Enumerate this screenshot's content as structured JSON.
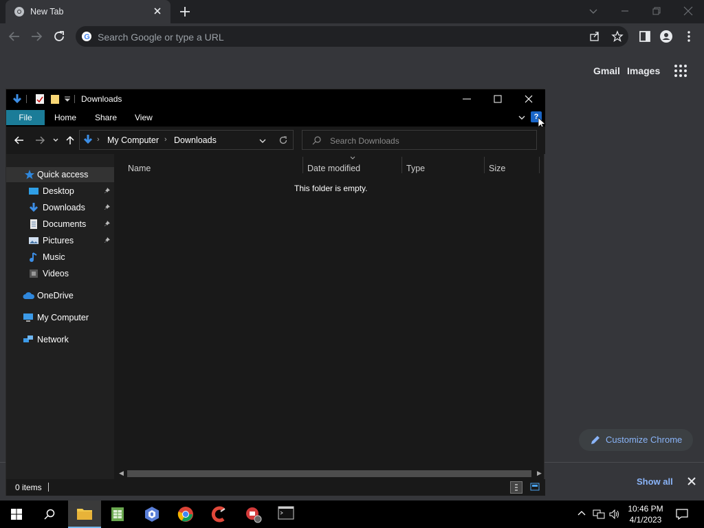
{
  "chrome": {
    "tab_title": "New Tab",
    "omnibox_placeholder": "Search Google or type a URL",
    "gmail": "Gmail",
    "images": "Images",
    "customize": "Customize Chrome",
    "show_all": "Show all"
  },
  "explorer": {
    "title": "Downloads",
    "ribbon": {
      "file": "File",
      "home": "Home",
      "share": "Share",
      "view": "View",
      "help": "?"
    },
    "address": {
      "crumbs": [
        "My Computer",
        "Downloads"
      ]
    },
    "search_placeholder": "Search Downloads",
    "nav": {
      "quick_access": "Quick access",
      "desktop": "Desktop",
      "downloads": "Downloads",
      "documents": "Documents",
      "pictures": "Pictures",
      "music": "Music",
      "videos": "Videos",
      "onedrive": "OneDrive",
      "my_computer": "My Computer",
      "network": "Network"
    },
    "columns": {
      "name": "Name",
      "date": "Date modified",
      "type": "Type",
      "size": "Size"
    },
    "empty_message": "This folder is empty.",
    "status": "0 items"
  },
  "taskbar": {
    "time": "10:46 PM",
    "date": "4/1/2023"
  },
  "colors": {
    "accent": "#1b7c98",
    "link": "#8ab4f8",
    "chrome_bg": "#35363a"
  }
}
